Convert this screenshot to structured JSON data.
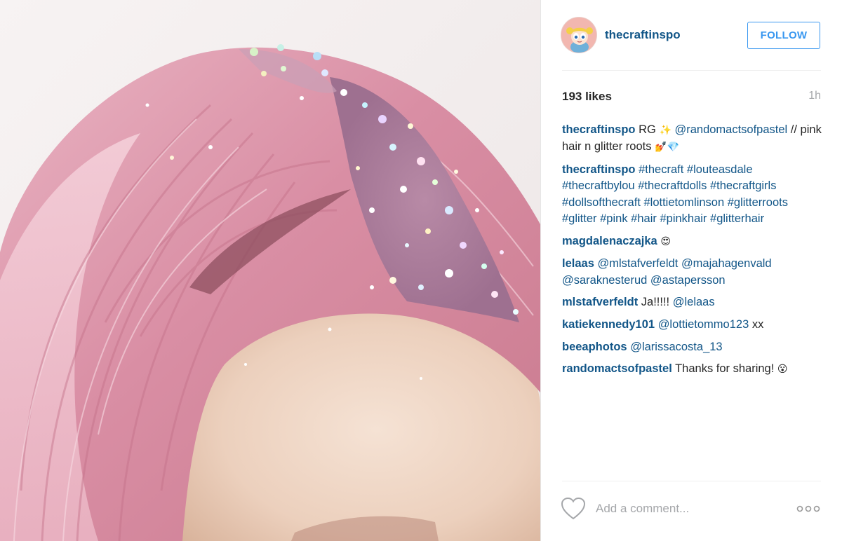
{
  "post": {
    "username": "thecraftinspo",
    "follow_label": "FOLLOW",
    "likes": "193 likes",
    "time": "1h",
    "comment_placeholder": "Add a comment...",
    "photo_description_icon": "photo"
  },
  "icons": {
    "like": "heart-outline-icon",
    "more": "more-options-icon",
    "avatar": "cartoon-avatar"
  },
  "colors": {
    "username": "#125688",
    "follow": "#3897f0",
    "muted": "#a5a7aa",
    "avatar_bg": "#f2b7b0"
  },
  "comments": [
    {
      "user": "thecraftinspo",
      "parts": [
        {
          "t": "text",
          "v": " RG "
        },
        {
          "t": "emoji",
          "v": "✨"
        },
        {
          "t": "text",
          "v": " "
        },
        {
          "t": "mention",
          "v": "@randomactsofpastel"
        },
        {
          "t": "text",
          "v": " // pink hair n glitter roots "
        },
        {
          "t": "emoji",
          "v": "💅💎"
        }
      ]
    },
    {
      "user": "thecraftinspo",
      "parts": [
        {
          "t": "text",
          "v": " "
        },
        {
          "t": "tag",
          "v": "#thecraft"
        },
        {
          "t": "text",
          "v": " "
        },
        {
          "t": "tag",
          "v": "#louteasdale"
        },
        {
          "t": "text",
          "v": " "
        },
        {
          "t": "tag",
          "v": "#thecraftbylou"
        },
        {
          "t": "text",
          "v": " "
        },
        {
          "t": "tag",
          "v": "#thecraftdolls"
        },
        {
          "t": "text",
          "v": " "
        },
        {
          "t": "tag",
          "v": "#thecraftgirls"
        },
        {
          "t": "text",
          "v": " "
        },
        {
          "t": "tag",
          "v": "#dollsofthecraft"
        },
        {
          "t": "text",
          "v": " "
        },
        {
          "t": "tag",
          "v": "#lottietomlinson"
        },
        {
          "t": "text",
          "v": " "
        },
        {
          "t": "tag",
          "v": "#glitterroots"
        },
        {
          "t": "text",
          "v": " "
        },
        {
          "t": "tag",
          "v": "#glitter"
        },
        {
          "t": "text",
          "v": " "
        },
        {
          "t": "tag",
          "v": "#pink"
        },
        {
          "t": "text",
          "v": " "
        },
        {
          "t": "tag",
          "v": "#hair"
        },
        {
          "t": "text",
          "v": " "
        },
        {
          "t": "tag",
          "v": "#pinkhair"
        },
        {
          "t": "text",
          "v": " "
        },
        {
          "t": "tag",
          "v": "#glitterhair"
        }
      ]
    },
    {
      "user": "magdalenaczajka",
      "parts": [
        {
          "t": "text",
          "v": " "
        },
        {
          "t": "emoji",
          "v": "😍"
        }
      ]
    },
    {
      "user": "lelaas",
      "parts": [
        {
          "t": "text",
          "v": " "
        },
        {
          "t": "mention",
          "v": "@mlstafverfeldt"
        },
        {
          "t": "text",
          "v": " "
        },
        {
          "t": "mention",
          "v": "@majahagenvald"
        },
        {
          "t": "text",
          "v": " "
        },
        {
          "t": "mention",
          "v": "@saraknesterud"
        },
        {
          "t": "text",
          "v": " "
        },
        {
          "t": "mention",
          "v": "@astapersson"
        }
      ]
    },
    {
      "user": "mlstafverfeldt",
      "parts": [
        {
          "t": "text",
          "v": " Ja!!!!! "
        },
        {
          "t": "mention",
          "v": "@lelaas"
        }
      ]
    },
    {
      "user": "katiekennedy101",
      "parts": [
        {
          "t": "text",
          "v": " "
        },
        {
          "t": "mention",
          "v": "@lottietommo123"
        },
        {
          "t": "text",
          "v": " xx"
        }
      ]
    },
    {
      "user": "beeaphotos",
      "parts": [
        {
          "t": "text",
          "v": " "
        },
        {
          "t": "mention",
          "v": "@larissacosta_13"
        }
      ]
    },
    {
      "user": "randomactsofpastel",
      "parts": [
        {
          "t": "text",
          "v": " Thanks for sharing! "
        },
        {
          "t": "emoji",
          "v": "😮"
        }
      ]
    }
  ]
}
